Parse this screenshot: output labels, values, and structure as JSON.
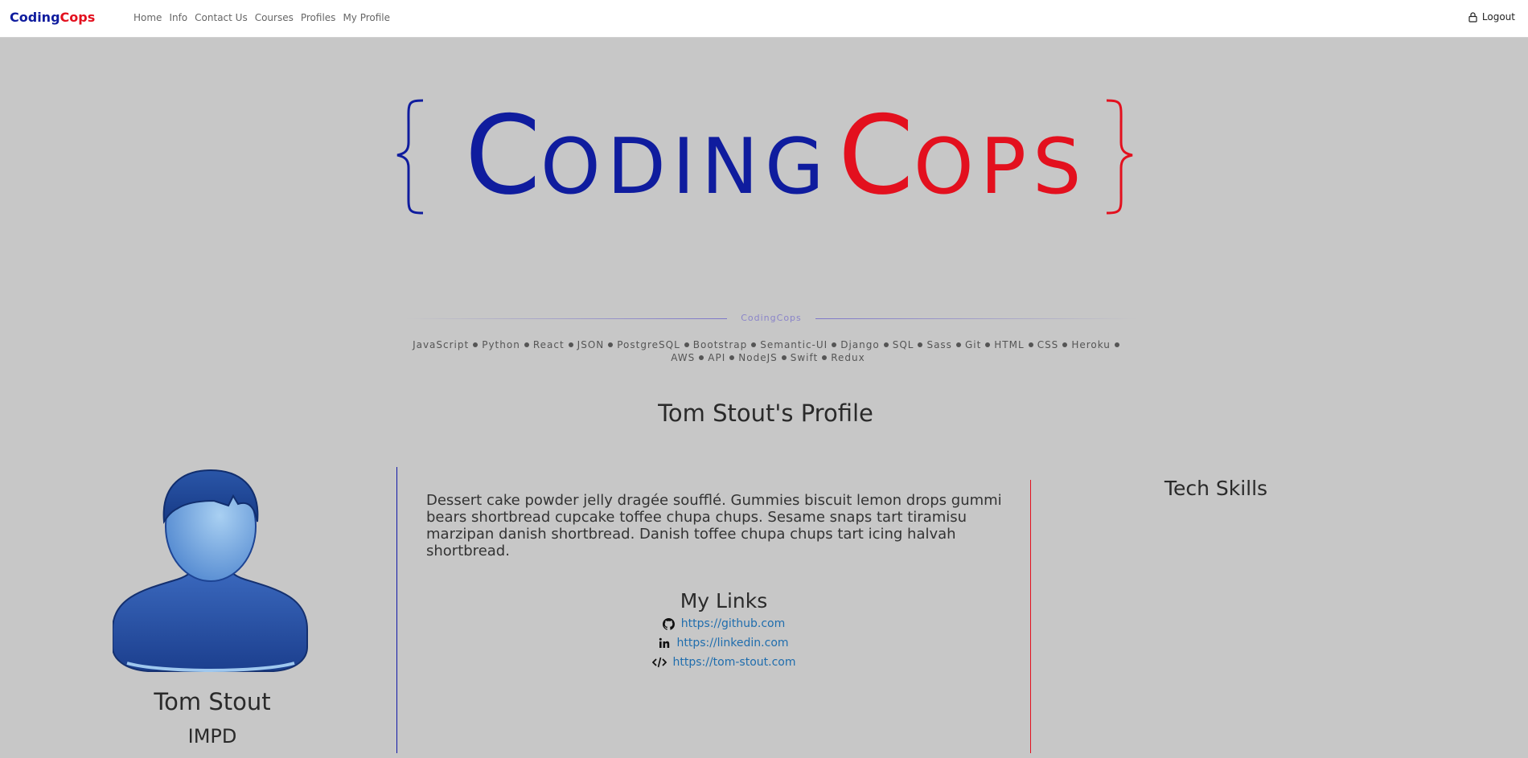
{
  "nav": {
    "brand_part1": "Coding",
    "brand_part2": "Cops",
    "links": [
      "Home",
      "Info",
      "Contact Us",
      "Courses",
      "Profiles",
      "My Profile"
    ],
    "logout_label": "Logout"
  },
  "hero": {
    "logo_part1": "Coding",
    "logo_part2": "Cops",
    "colors": {
      "blue": "#0f1c9e",
      "red": "#e3101e"
    }
  },
  "tagline": {
    "label": "CodingCops",
    "tech_line1": [
      "JavaScript",
      "Python",
      "React",
      "JSON",
      "PostgreSQL",
      "Bootstrap",
      "Semantic-UI",
      "Django",
      "SQL",
      "Sass",
      "Git",
      "HTML",
      "CSS",
      "Heroku"
    ],
    "tech_line2": [
      "AWS",
      "API",
      "NodeJS",
      "Swift",
      "Redux"
    ]
  },
  "profile": {
    "title": "Tom Stout's Profile",
    "name": "Tom Stout",
    "department": "IMPD",
    "bio": "Dessert cake powder jelly dragée soufflé. Gummies biscuit lemon drops gummi bears shortbread cupcake toffee chupa chups. Sesame snaps tart tiramisu marzipan danish shortbread. Danish toffee chupa chups tart icing halvah shortbread.",
    "links_title": "My Links",
    "links": [
      {
        "icon": "github-icon",
        "url": "https://github.com"
      },
      {
        "icon": "linkedin-icon",
        "url": "https://linkedin.com"
      },
      {
        "icon": "code-icon",
        "url": "https://tom-stout.com"
      }
    ],
    "tech_skills_title": "Tech Skills"
  }
}
